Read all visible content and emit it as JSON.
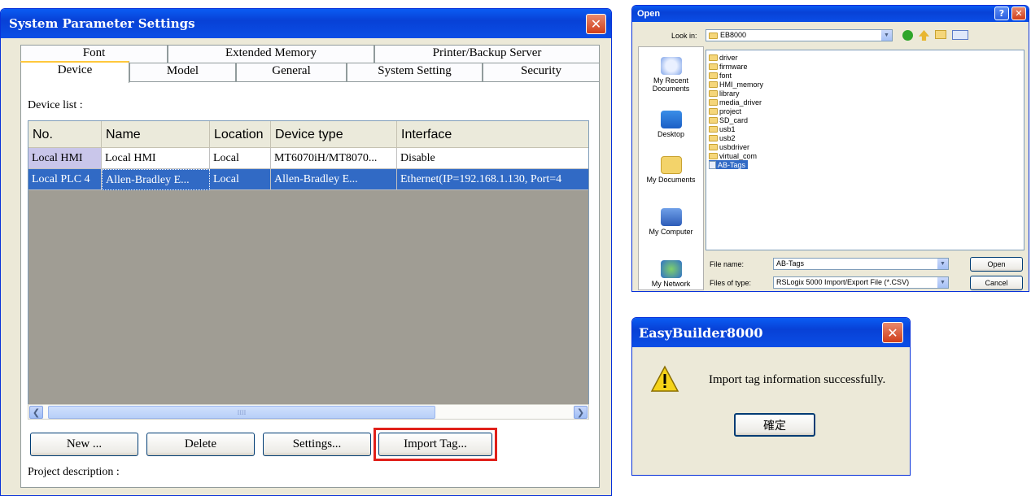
{
  "main_dialog": {
    "title": "System Parameter Settings",
    "tabs_row1": [
      "Font",
      "Extended Memory",
      "Printer/Backup Server"
    ],
    "tabs_row2": [
      "Device",
      "Model",
      "General",
      "System Setting",
      "Security"
    ],
    "active_tab": "Device",
    "device_list_label": "Device list :",
    "columns": [
      "No.",
      "Name",
      "Location",
      "Device type",
      "Interface"
    ],
    "rows": [
      [
        "Local HMI",
        "Local HMI",
        "Local",
        "MT6070iH/MT8070...",
        "Disable"
      ],
      [
        "Local PLC 4",
        "Allen-Bradley E...",
        "Local",
        "Allen-Bradley E...",
        "Ethernet(IP=192.168.1.130, Port=4"
      ]
    ],
    "buttons": {
      "new": "New ...",
      "delete": "Delete",
      "settings": "Settings...",
      "import_tag": "Import Tag..."
    },
    "project_description_label": "Project description :"
  },
  "open_dialog": {
    "title": "Open",
    "look_in_label": "Look in:",
    "look_in_value": "EB8000",
    "places": [
      "My Recent Documents",
      "Desktop",
      "My Documents",
      "My Computer",
      "My Network"
    ],
    "folders": [
      "driver",
      "firmware",
      "font",
      "HMI_memory",
      "library",
      "media_driver",
      "project",
      "SD_card",
      "usb1",
      "usb2",
      "usbdriver",
      "virtual_com"
    ],
    "selected_file": "AB-Tags",
    "file_name_label": "File name:",
    "file_name_value": "AB-Tags",
    "file_type_label": "Files of type:",
    "file_type_value": "RSLogix 5000 Import/Export File (*.CSV)",
    "open_button": "Open",
    "cancel_button": "Cancel"
  },
  "message_dialog": {
    "title": "EasyBuilder8000",
    "message": "Import tag information successfully.",
    "ok_button": "確定"
  },
  "colors": {
    "titlebar": "#0a4ee6",
    "selection": "#316ac5",
    "highlight_box": "#e0201a",
    "dialog_bg": "#ece9d8"
  }
}
